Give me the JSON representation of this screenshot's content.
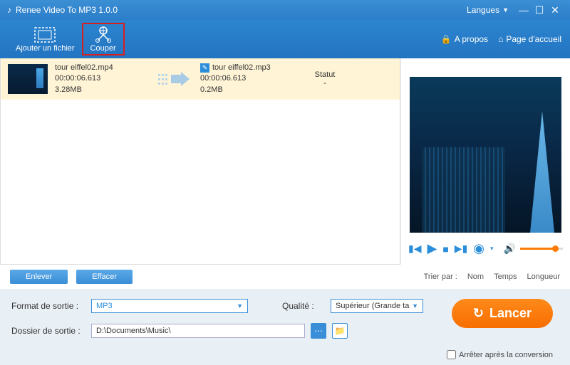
{
  "titlebar": {
    "title": "Renee Video To MP3 1.0.0",
    "languages": "Langues"
  },
  "header": {
    "add_file": "Ajouter un fichier",
    "cut": "Couper",
    "about": "A propos",
    "home": "Page d'accueil"
  },
  "file": {
    "in_name": "tour eiffel02.mp4",
    "in_duration": "00:00:06.613",
    "in_size": "3.28MB",
    "out_name": "tour eiffel02.mp3",
    "out_duration": "00:00:06.613",
    "out_size": "0.2MB",
    "status_label": "Statut",
    "status_value": "-"
  },
  "actions": {
    "remove": "Enlever",
    "clear": "Effacer",
    "sort_label": "Trier par :",
    "sort_name": "Nom",
    "sort_time": "Temps",
    "sort_length": "Longueur"
  },
  "settings": {
    "format_label": "Format de sortie :",
    "format_value": "MP3",
    "quality_label": "Qualité :",
    "quality_value": "Supérieur (Grande ta",
    "folder_label": "Dossier de sortie :",
    "folder_value": "D:\\Documents\\Music\\",
    "launch": "Lancer",
    "stop_after": "Arrêter après la conversion"
  }
}
